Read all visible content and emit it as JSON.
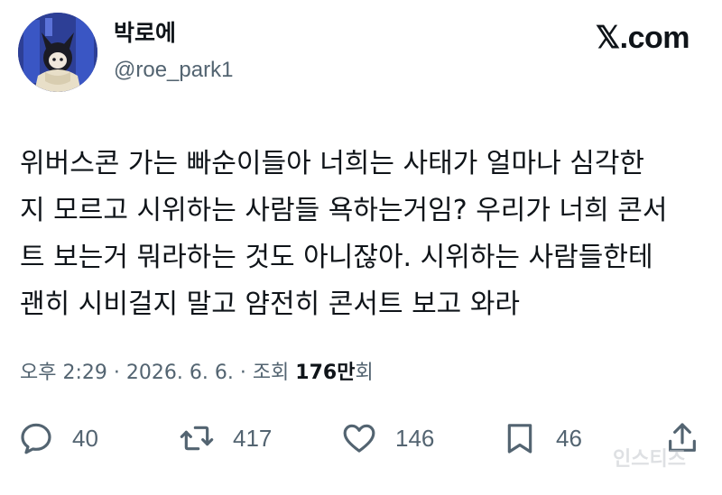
{
  "author": {
    "display_name": "박로에",
    "handle": "@roe_park1"
  },
  "brand": "𝕏.com",
  "tweet": {
    "lines": [
      "위버스콘 가는 빠순이들아 너희는 사태가 얼마나 심각한",
      "지 모르고 시위하는 사람들 욕하는거임? 우리가 너희 콘서",
      "트 보는거 뭐라하는 것도 아니잖아. 시위하는 사람들한테",
      "괜히 시비걸지 말고 얌전히 콘서트 보고 와라"
    ]
  },
  "meta": {
    "time": "오후 2:29",
    "separator1": " · ",
    "date": "2026. 6. 6.",
    "separator2": " · ",
    "views_label": "조회 ",
    "views_count": "176만",
    "views_suffix": "회"
  },
  "actions": {
    "reply_count": "40",
    "repost_count": "417",
    "like_count": "146",
    "bookmark_count": "46"
  },
  "watermark": "인스티즈",
  "icons": [
    "reply-icon",
    "repost-icon",
    "like-icon",
    "bookmark-icon",
    "share-icon"
  ]
}
